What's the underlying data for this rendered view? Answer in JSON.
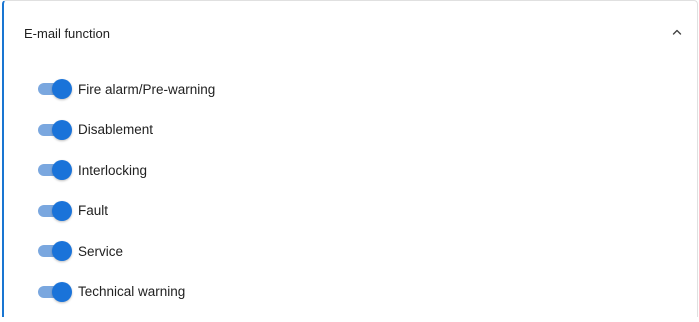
{
  "panel": {
    "title": "E-mail function",
    "expanded": true,
    "chevron_icon": "chevron-up-icon",
    "accent_color": "#1976d2"
  },
  "toggles": [
    {
      "label": "Fire alarm/Pre-warning",
      "checked": true
    },
    {
      "label": "Disablement",
      "checked": true
    },
    {
      "label": "Interlocking",
      "checked": true
    },
    {
      "label": "Fault",
      "checked": true
    },
    {
      "label": "Service",
      "checked": true
    },
    {
      "label": "Technical warning",
      "checked": true
    }
  ]
}
